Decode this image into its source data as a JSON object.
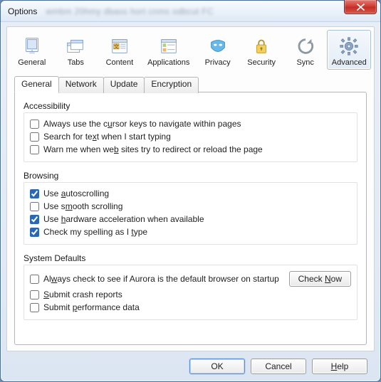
{
  "window": {
    "title": "Options",
    "blur_text": "wmbm 20hmy  dbass hort cnms odbcut FC"
  },
  "categories": [
    {
      "id": "general",
      "label": "General"
    },
    {
      "id": "tabs",
      "label": "Tabs"
    },
    {
      "id": "content",
      "label": "Content"
    },
    {
      "id": "applications",
      "label": "Applications"
    },
    {
      "id": "privacy",
      "label": "Privacy"
    },
    {
      "id": "security",
      "label": "Security"
    },
    {
      "id": "sync",
      "label": "Sync"
    },
    {
      "id": "advanced",
      "label": "Advanced",
      "selected": true
    }
  ],
  "tabs": [
    {
      "id": "general",
      "label": "General",
      "active": true
    },
    {
      "id": "network",
      "label": "Network"
    },
    {
      "id": "update",
      "label": "Update"
    },
    {
      "id": "encryption",
      "label": "Encryption"
    }
  ],
  "groups": {
    "accessibility": {
      "title": "Accessibility",
      "items": [
        {
          "pre": "Always use the c",
          "u": "u",
          "post": "rsor keys to navigate within pages",
          "checked": false
        },
        {
          "pre": "Search for te",
          "u": "x",
          "post": "t when I start typing",
          "checked": false
        },
        {
          "pre": "Warn me when we",
          "u": "b",
          "post": " sites try to redirect or reload the page",
          "checked": false
        }
      ]
    },
    "browsing": {
      "title": "Browsing",
      "items": [
        {
          "pre": "Use ",
          "u": "a",
          "post": "utoscrolling",
          "checked": true
        },
        {
          "pre": "Use s",
          "u": "m",
          "post": "ooth scrolling",
          "checked": false
        },
        {
          "pre": "Use ",
          "u": "h",
          "post": "ardware acceleration when available",
          "checked": true
        },
        {
          "pre": "Check my spelling as I ",
          "u": "t",
          "post": "ype",
          "checked": true
        }
      ]
    },
    "defaults": {
      "title": "System Defaults",
      "items": [
        {
          "pre": "Al",
          "u": "w",
          "post": "ays check to see if Aurora is the default browser on startup",
          "checked": false
        },
        {
          "pre": "",
          "u": "S",
          "post": "ubmit crash reports",
          "checked": false
        },
        {
          "pre": "Submit ",
          "u": "p",
          "post": "erformance data",
          "checked": false
        }
      ],
      "check_now_pre": "Check ",
      "check_now_u": "N",
      "check_now_post": "ow"
    }
  },
  "buttons": {
    "ok": "OK",
    "cancel": "Cancel",
    "help_u": "H",
    "help_post": "elp"
  }
}
